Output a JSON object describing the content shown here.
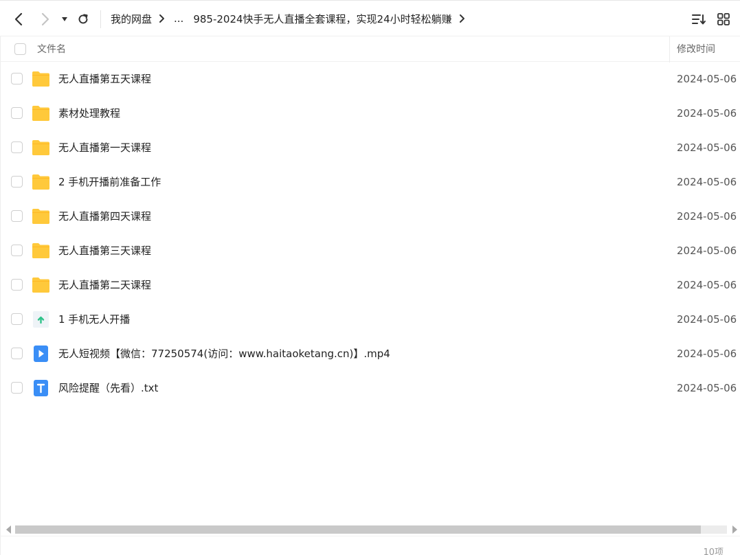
{
  "toolbar": {
    "back_icon": "chevron-left-icon",
    "forward_icon": "chevron-right-icon",
    "history_icon": "caret-down-icon",
    "refresh_icon": "refresh-icon",
    "sort_icon": "sort-icon",
    "grid_icon": "grid-view-icon"
  },
  "breadcrumb": {
    "root": "我的网盘",
    "ellipsis": "...",
    "current": "985-2024快手无人直播全套课程，实现24小时轻松躺赚"
  },
  "columns": {
    "name": "文件名",
    "modified": "修改时间"
  },
  "files": [
    {
      "name": "无人直播第五天课程",
      "modified": "2024-05-06",
      "type": "folder"
    },
    {
      "name": "素材处理教程",
      "modified": "2024-05-06",
      "type": "folder"
    },
    {
      "name": "无人直播第一天课程",
      "modified": "2024-05-06",
      "type": "folder"
    },
    {
      "name": "2 手机开播前准备工作",
      "modified": "2024-05-06",
      "type": "folder"
    },
    {
      "name": "无人直播第四天课程",
      "modified": "2024-05-06",
      "type": "folder"
    },
    {
      "name": "无人直播第三天课程",
      "modified": "2024-05-06",
      "type": "folder"
    },
    {
      "name": "无人直播第二天课程",
      "modified": "2024-05-06",
      "type": "folder"
    },
    {
      "name": "1 手机无人开播",
      "modified": "2024-05-06",
      "type": "apk"
    },
    {
      "name": "无人短视频【微信：77250574(访问：www.haitaoketang.cn)】.mp4",
      "modified": "2024-05-06",
      "type": "video"
    },
    {
      "name": "风险提醒（先看）.txt",
      "modified": "2024-05-06",
      "type": "text"
    }
  ],
  "footer": {
    "count": "10项"
  },
  "colors": {
    "folder": "#FFC93C",
    "video": "#3A8EF6",
    "text": "#3A8EF6",
    "apk": "#2FC28A"
  }
}
